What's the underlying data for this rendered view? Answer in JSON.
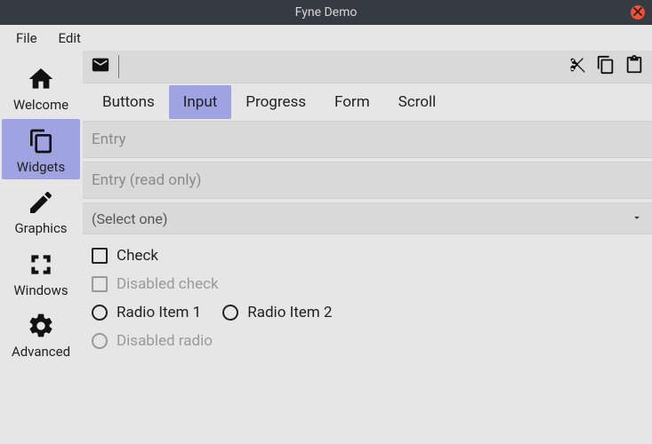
{
  "window": {
    "title": "Fyne Demo"
  },
  "menubar": {
    "file": "File",
    "edit": "Edit"
  },
  "sidebar": {
    "items": [
      {
        "label": "Welcome"
      },
      {
        "label": "Widgets"
      },
      {
        "label": "Graphics"
      },
      {
        "label": "Windows"
      },
      {
        "label": "Advanced"
      }
    ]
  },
  "tabs": {
    "items": [
      {
        "label": "Buttons"
      },
      {
        "label": "Input"
      },
      {
        "label": "Progress"
      },
      {
        "label": "Form"
      },
      {
        "label": "Scroll"
      }
    ]
  },
  "form": {
    "entry_placeholder": "Entry",
    "entry_readonly": "Entry (read only)",
    "select_placeholder": "(Select one)",
    "check_label": "Check",
    "disabled_check_label": "Disabled check",
    "radio1_label": "Radio Item 1",
    "radio2_label": "Radio Item 2",
    "disabled_radio_label": "Disabled radio"
  },
  "icons": {
    "mail": "mail-icon",
    "cut": "cut-icon",
    "copy": "copy-icon",
    "paste": "paste-icon"
  }
}
